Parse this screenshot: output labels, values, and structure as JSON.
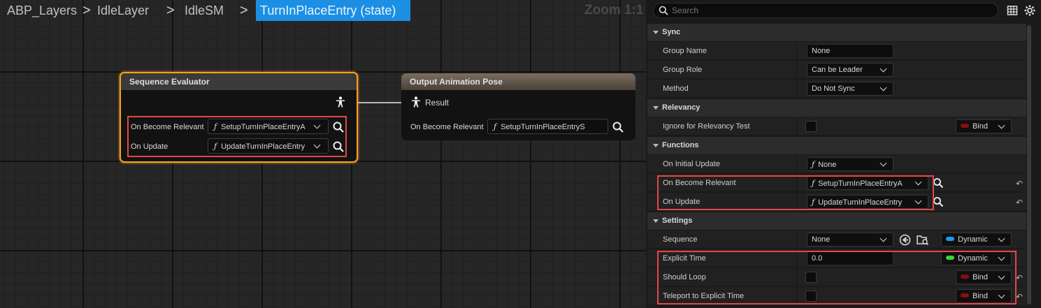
{
  "breadcrumb": {
    "items": [
      "ABP_Layers",
      "IdleLayer",
      "IdleSM"
    ],
    "separators": [
      ">",
      ">",
      ">"
    ],
    "active": "TurnInPlaceEntry (state)"
  },
  "graph": {
    "zoom_label": "Zoom 1:1",
    "sequence_evaluator": {
      "title": "Sequence Evaluator",
      "pins": [
        {
          "label": "On Become Relevant",
          "value": "SetupTurnInPlaceEntryA"
        },
        {
          "label": "On Update",
          "value": "UpdateTurnInPlaceEntry"
        }
      ]
    },
    "output_pose": {
      "title": "Output Animation Pose",
      "result_label": "Result",
      "pin_label": "On Become Relevant",
      "pin_value": "SetupTurnInPlaceEntryS"
    }
  },
  "details": {
    "search_placeholder": "Search",
    "sections": {
      "sync": "Sync",
      "relevancy": "Relevancy",
      "functions": "Functions",
      "settings": "Settings"
    },
    "rows": {
      "group_name": {
        "label": "Group Name",
        "value": "None"
      },
      "group_role": {
        "label": "Group Role",
        "value": "Can be Leader"
      },
      "method": {
        "label": "Method",
        "value": "Do Not Sync"
      },
      "ignore_relevancy": {
        "label": "Ignore for Relevancy Test",
        "bind": "Bind"
      },
      "on_initial_update": {
        "label": "On Initial Update",
        "value": "None"
      },
      "on_become_relevant": {
        "label": "On Become Relevant",
        "value": "SetupTurnInPlaceEntryA"
      },
      "on_update": {
        "label": "On Update",
        "value": "UpdateTurnInPlaceEntry"
      },
      "sequence": {
        "label": "Sequence",
        "value": "None",
        "mode": "Dynamic"
      },
      "explicit_time": {
        "label": "Explicit Time",
        "value": "0.0",
        "mode": "Dynamic"
      },
      "should_loop": {
        "label": "Should Loop",
        "bind": "Bind"
      },
      "teleport": {
        "label": "Teleport to Explicit Time",
        "bind": "Bind"
      }
    }
  },
  "colors": {
    "accent_blue": "#1b8fe3",
    "selection_orange": "#f6a21c",
    "highlight_red": "#e4474a",
    "pill_blue": "#1e9bf0",
    "pill_green": "#3fd23a",
    "pill_red": "#8a0d0d"
  }
}
